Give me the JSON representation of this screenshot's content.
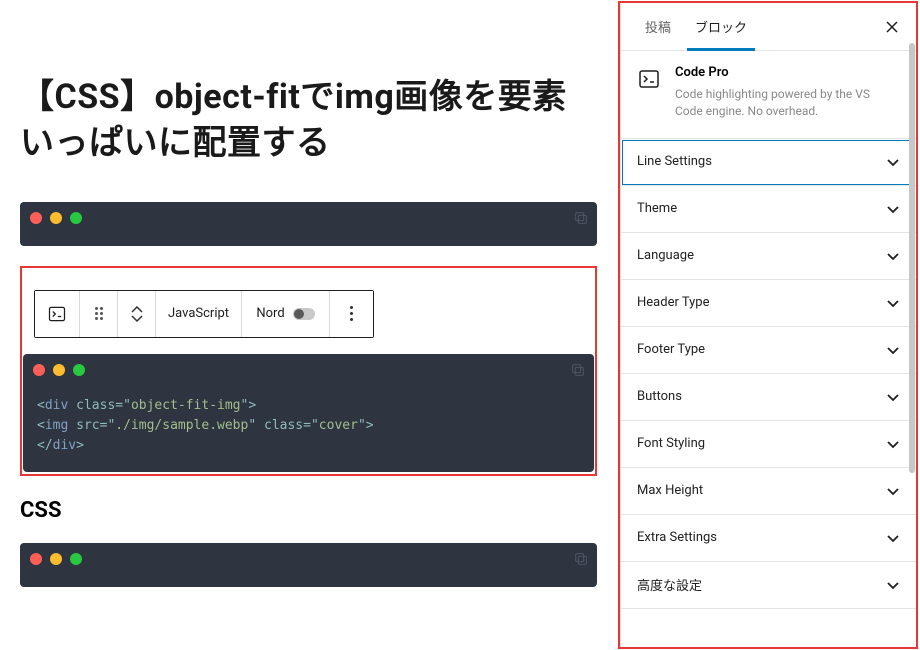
{
  "page": {
    "title": "【CSS】object-fitでimg画像を要素いっぱいに配置する"
  },
  "toolbar": {
    "language": "JavaScript",
    "theme": "Nord"
  },
  "code": {
    "line1_open": "<",
    "line1_tag": "div",
    "line1_sp": " ",
    "line1_attr": "class",
    "line1_eq": "=\"",
    "line1_val": "object-fit-img",
    "line1_close": "\">",
    "line2_indent": "    ",
    "line2_open": "<",
    "line2_tag": "img",
    "line2_sp": " ",
    "line2_attr1": "src",
    "line2_eq1": "=\"",
    "line2_val1": "./img/sample.webp",
    "line2_mid": "\" ",
    "line2_attr2": "class",
    "line2_eq2": "=\"",
    "line2_val2": "cover",
    "line2_close": "\">",
    "line3_open": "</",
    "line3_tag": "div",
    "line3_close": ">"
  },
  "section": {
    "css": "CSS"
  },
  "sidebar": {
    "tabs": {
      "post": "投稿",
      "block": "ブロック"
    },
    "block_name": "Code Pro",
    "block_desc": "Code highlighting powered by the VS Code engine. No overhead.",
    "panels": {
      "line_settings": "Line Settings",
      "theme": "Theme",
      "language": "Language",
      "header_type": "Header Type",
      "footer_type": "Footer Type",
      "buttons": "Buttons",
      "font_styling": "Font Styling",
      "max_height": "Max Height",
      "extra_settings": "Extra Settings",
      "advanced": "高度な設定"
    }
  }
}
